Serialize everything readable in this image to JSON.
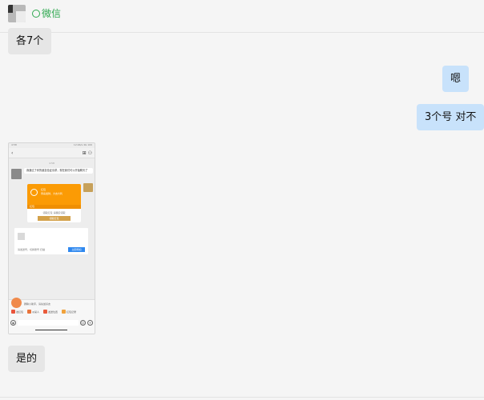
{
  "header": {
    "app_label": "微信"
  },
  "messages": [
    {
      "side": "left",
      "text": "各7个"
    },
    {
      "side": "right",
      "text": "嗯"
    },
    {
      "side": "right",
      "text": "3个号 对不"
    },
    {
      "side": "left",
      "type": "image"
    },
    {
      "side": "left",
      "text": "是的"
    }
  ],
  "screenshot": {
    "status_left": "4:58",
    "status_right": "12.9K/s 4G 100",
    "nav_title": "",
    "time_divider": "4:58",
    "first_msg": "我通过了你的朋友验证请求，现在我们可以开始聊天了",
    "card_title": "红包",
    "card_sub": "恭喜发财，大吉大利",
    "card_foot": "红包",
    "card_caption": "领取红包 请确定领取",
    "card_button": "领取红包",
    "ext_line": "请发送号，切换账号 扫描",
    "ext_button": "立即添加",
    "tip": "群聊小助手，请先加好友",
    "quick": [
      "发红包",
      "@某人",
      "发送位置",
      "红包记录"
    ]
  }
}
